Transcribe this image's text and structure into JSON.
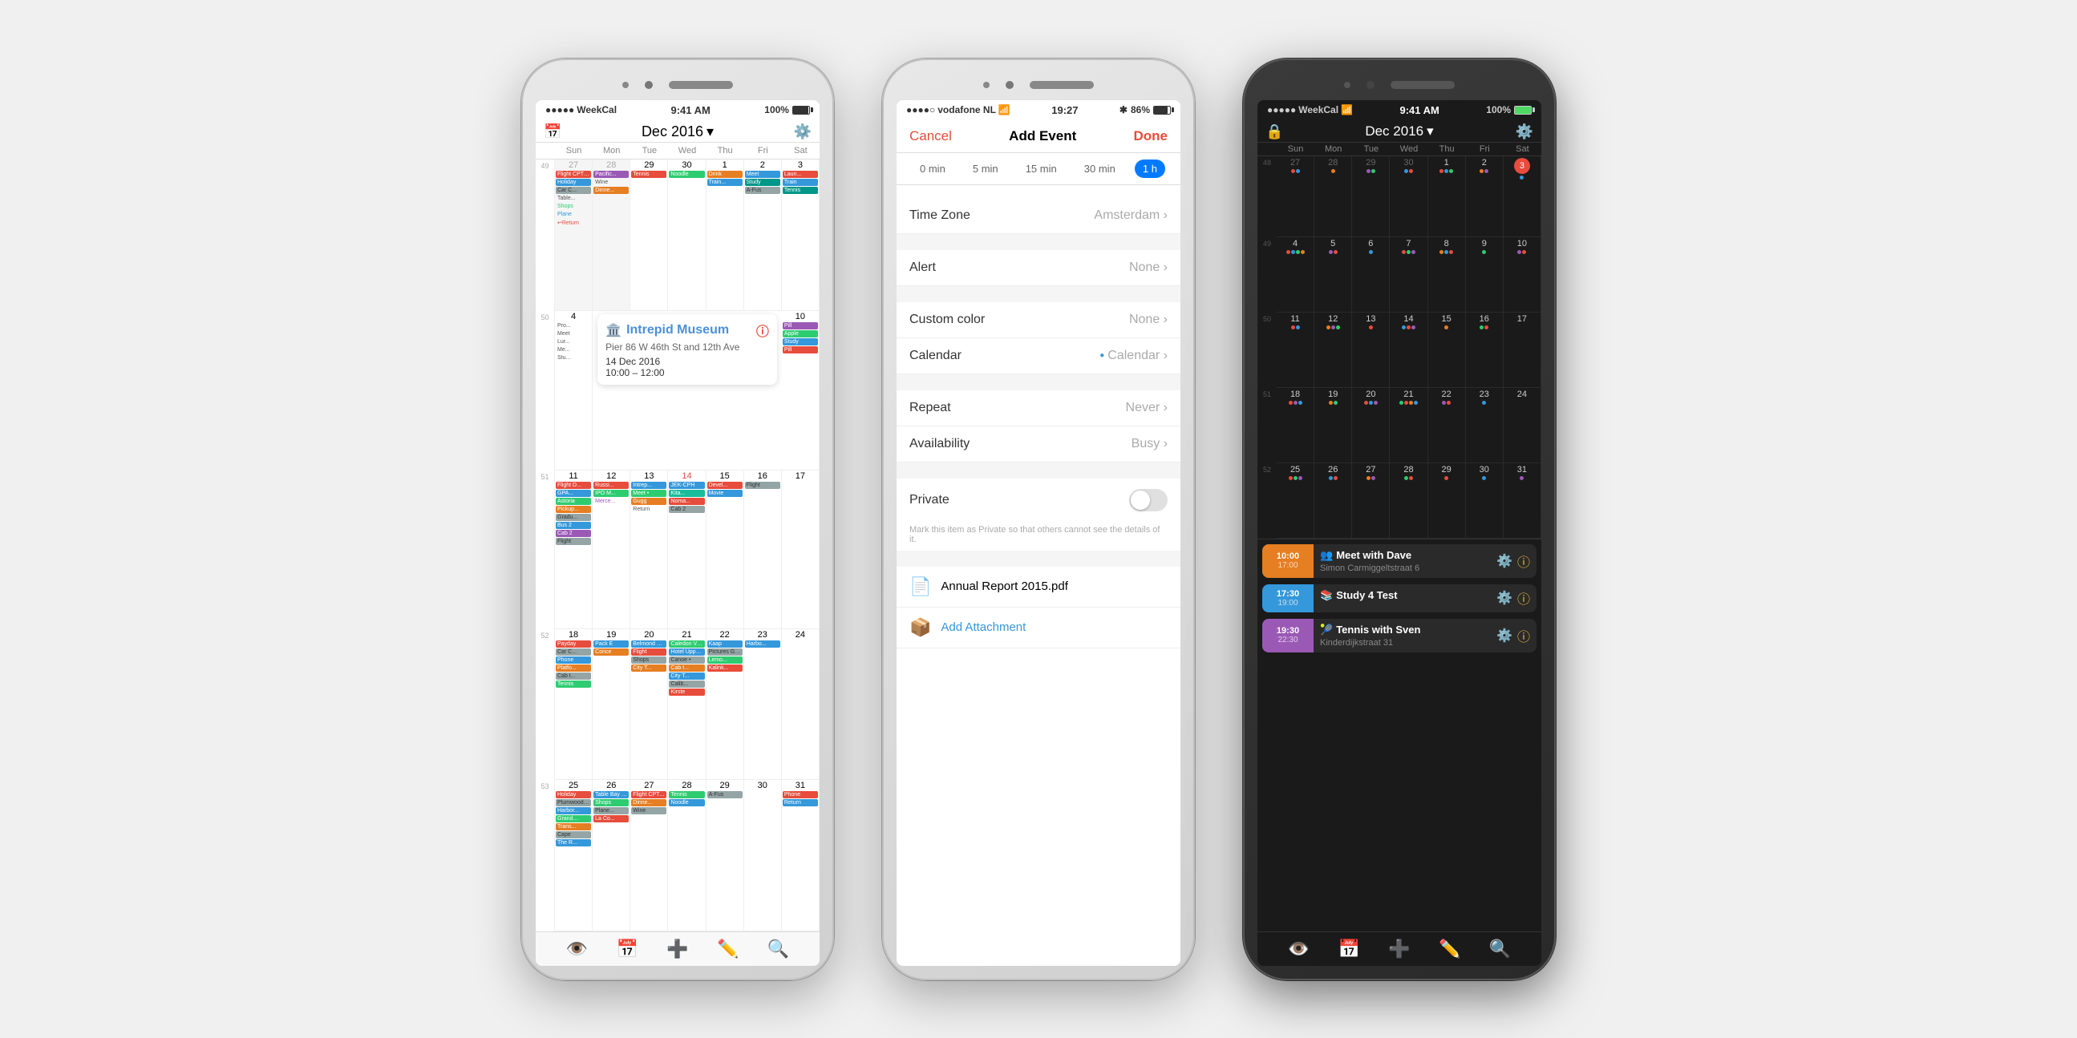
{
  "phones": {
    "left": {
      "statusBar": {
        "carrier": "WeekCal",
        "wifi": "WiFi",
        "time": "9:41 AM",
        "battery": "100%"
      },
      "header": {
        "month": "Dec 2016",
        "calendarIcon": "📅",
        "gearIcon": "⚙️"
      },
      "weekDays": [
        "",
        "Sun",
        "Mon",
        "Tue",
        "Wed",
        "Thu",
        "Fri",
        "Sat"
      ],
      "popup": {
        "emoji": "🏛️",
        "title": "Intrepid Museum",
        "address": "Pier 86 W 46th St and 12th Ave",
        "date": "14 Dec 2016",
        "timeStart": "10:00",
        "timeEnd": "12:00"
      },
      "bottomIcons": [
        "👁️",
        "📅",
        "➕",
        "✏️",
        "🔍"
      ]
    },
    "middle": {
      "statusBar": {
        "carrier": "vodafone NL",
        "wifi": "WiFi",
        "time": "19:27",
        "bluetooth": "86%"
      },
      "header": {
        "cancel": "Cancel",
        "title": "Add Event",
        "done": "Done"
      },
      "timePills": [
        "0 min",
        "5 min",
        "15 min",
        "30 min",
        "1 h"
      ],
      "activePill": "1 h",
      "rows": [
        {
          "label": "Time Zone",
          "value": "Amsterdam"
        },
        {
          "label": "Alert",
          "value": "None"
        },
        {
          "label": "Custom color",
          "value": "None"
        },
        {
          "label": "Calendar",
          "value": "Calendar",
          "dot": true
        },
        {
          "label": "Repeat",
          "value": "Never"
        },
        {
          "label": "Availability",
          "value": "Busy"
        },
        {
          "label": "Private",
          "value": "toggle",
          "toggle": false
        }
      ],
      "privateNote": "Mark this item as Private so that others cannot see the details of it.",
      "attachments": [
        {
          "icon": "📄",
          "label": "Annual Report 2015.pdf"
        },
        {
          "icon": "dropbox",
          "label": "Add Attachment"
        }
      ]
    },
    "right": {
      "statusBar": {
        "carrier": "WeekCal",
        "wifi": "WiFi",
        "time": "9:41 AM",
        "battery": "100%"
      },
      "header": {
        "month": "Dec 2016"
      },
      "weekDays": [
        "",
        "Sun",
        "Mon",
        "Tue",
        "Wed",
        "Thu",
        "Fri",
        "Sat"
      ],
      "events": [
        {
          "startTime": "10:00",
          "endTime": "17:00",
          "emoji": "👥",
          "title": "Meet with Dave",
          "subtitle": "Simon Carmiggeltstraat 6",
          "color": "#e67e22"
        },
        {
          "startTime": "17:30",
          "endTime": "19:00",
          "emoji": "📚",
          "title": "Study 4 Test",
          "subtitle": "",
          "color": "#3498db"
        },
        {
          "startTime": "19:30",
          "endTime": "22:30",
          "emoji": "🎾",
          "title": "Tennis with Sven",
          "subtitle": "Kinderdijkstraat 31",
          "color": "#9b59b6"
        }
      ],
      "bottomIcons": [
        "👁️",
        "📅",
        "➕",
        "✏️",
        "🔍"
      ]
    }
  }
}
